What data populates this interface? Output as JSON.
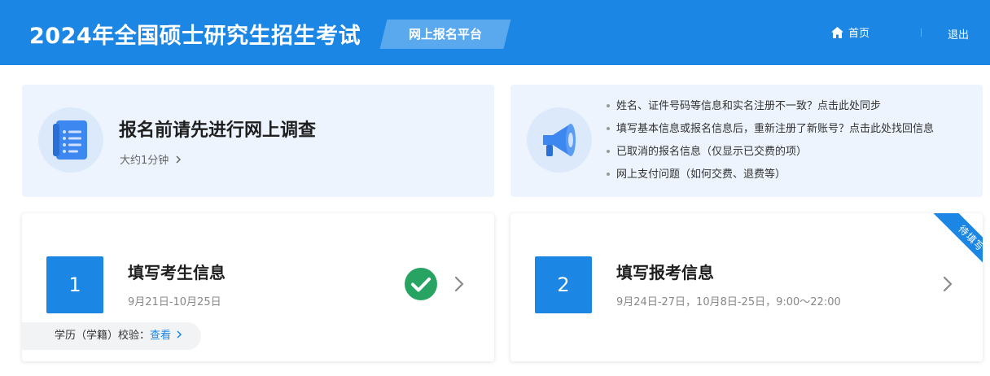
{
  "header": {
    "title": "2024年全国硕士研究生招生考试",
    "platform_label": "网上报名平台",
    "nav": {
      "home_label": "首页",
      "logout_label": "退出"
    }
  },
  "survey": {
    "title": "报名前请先进行网上调查",
    "subtitle": "大约1分钟"
  },
  "help_links": [
    {
      "label": "姓名、证件号码等信息和实名注册不一致？点击此处同步"
    },
    {
      "label": "填写基本信息或报名信息后，重新注册了新账号？点击此处找回信息"
    },
    {
      "label": "已取消的报名信息（仅显示已交费的项）"
    },
    {
      "label": "网上支付问题（如何交费、退费等）"
    }
  ],
  "steps": [
    {
      "number": "1",
      "title": "填写考生信息",
      "date": "9月21日-10月25日",
      "verify_label": "学历（学籍）校验：",
      "verify_link": "查看"
    },
    {
      "number": "2",
      "title": "填写报考信息",
      "date": "9月24日-27日，10月8日-25日，9:00～22:00",
      "ribbon": "待填写"
    }
  ],
  "colors": {
    "primary": "#1b86e3",
    "header_bg": "#1b86e3",
    "panel_bg": "#edf4fd",
    "success": "#27a462",
    "ribbon": "#1b86e3"
  },
  "icons": {
    "home": "home-icon",
    "survey": "document-icon",
    "announce": "megaphone-icon",
    "done": "check-circle-icon",
    "next": "chevron-right-icon"
  }
}
